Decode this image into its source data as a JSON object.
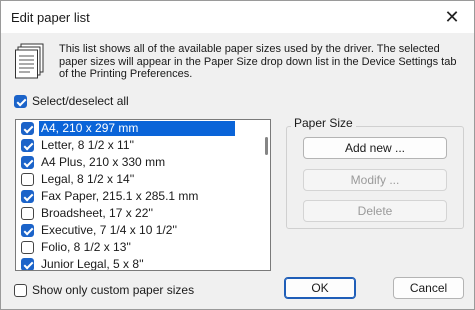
{
  "dialog": {
    "title": "Edit paper list",
    "description": "This list shows all of the available paper sizes used by the driver. The selected paper sizes will appear in the Paper Size drop down list in the Device Settings tab of the Printing Preferences.",
    "select_all_label": "Select/deselect all",
    "show_custom_label": "Show only custom paper sizes"
  },
  "paper_list": [
    {
      "label": "A4, 210 x 297 mm",
      "checked": true,
      "selected": true
    },
    {
      "label": "Letter, 8 1/2 x 11''",
      "checked": true,
      "selected": false
    },
    {
      "label": "A4 Plus, 210 x 330 mm",
      "checked": true,
      "selected": false
    },
    {
      "label": "Legal, 8 1/2 x 14''",
      "checked": false,
      "selected": false
    },
    {
      "label": "Fax Paper, 215.1 x 285.1 mm",
      "checked": true,
      "selected": false
    },
    {
      "label": "Broadsheet, 17 x 22''",
      "checked": false,
      "selected": false
    },
    {
      "label": "Executive, 7 1/4 x 10 1/2''",
      "checked": true,
      "selected": false
    },
    {
      "label": "Folio, 8 1/2 x 13''",
      "checked": false,
      "selected": false
    },
    {
      "label": "Junior Legal, 5 x 8''",
      "checked": true,
      "selected": false
    }
  ],
  "paper_size_group": {
    "label": "Paper Size",
    "add_new": "Add new ...",
    "modify": "Modify ...",
    "delete": "Delete"
  },
  "buttons": {
    "ok": "OK",
    "cancel": "Cancel"
  },
  "icons": {
    "close": "close-icon",
    "document": "document-stack-icon"
  },
  "colors": {
    "accent": "#1b63c9",
    "selection": "#0a64d8"
  }
}
